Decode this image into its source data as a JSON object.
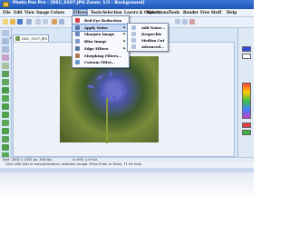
{
  "window": {
    "title": "Photo Pos Pro - [DSC_0107.JPG  Zoom: 1/2 - Background]"
  },
  "menu": {
    "items": [
      "File",
      "Edit",
      "View",
      "Image",
      "Colors",
      "Filters",
      "Tools",
      "Selection",
      "Layers & Objects",
      "Selections",
      "Tools",
      "Render",
      "Free Stuff",
      "Help"
    ],
    "active_index": 5
  },
  "document": {
    "tab_label": "DSC_0107.JPG"
  },
  "filters_menu": {
    "items": [
      {
        "label": "Red Eye Reduction",
        "icon": "red-eye-icon",
        "color": "#d04040",
        "submenu": false
      },
      {
        "label": "Apply Noise",
        "icon": "noise-icon",
        "color": "#5577aa",
        "submenu": true
      },
      {
        "label": "Sharpen Image",
        "icon": "sharpen-icon",
        "color": "#6688bb",
        "submenu": true
      },
      {
        "label": "Blur Image",
        "icon": "blur-icon",
        "color": "#7799cc",
        "submenu": true
      },
      {
        "label": "Edge Filters",
        "icon": "edge-icon",
        "color": "#557799",
        "submenu": true
      },
      {
        "label": "Morphing Filters...",
        "icon": "morph-icon",
        "color": "#aa7755",
        "submenu": false
      },
      {
        "label": "Custom Filter...",
        "icon": "custom-filter-icon",
        "color": "#6699cc",
        "submenu": false
      }
    ],
    "highlighted_index": 1
  },
  "noise_submenu": {
    "items": [
      "Add Noise...",
      "Despeckle",
      "Median Cut",
      "Advanced..."
    ]
  },
  "status": {
    "size": "Size: 2000 x 1532 px, 300 dpi",
    "coords": "x=555, y=9 px"
  },
  "hint": {
    "text": "Click Left/ Add to move/transform selection image. Press Enter to finish, F1 for help"
  },
  "colors": {
    "title_bar": "#2a63c4",
    "menu_highlight": "#c7d8f4",
    "foreground_swatch": "#2b4dd8",
    "background_swatch": "#ffffff"
  }
}
